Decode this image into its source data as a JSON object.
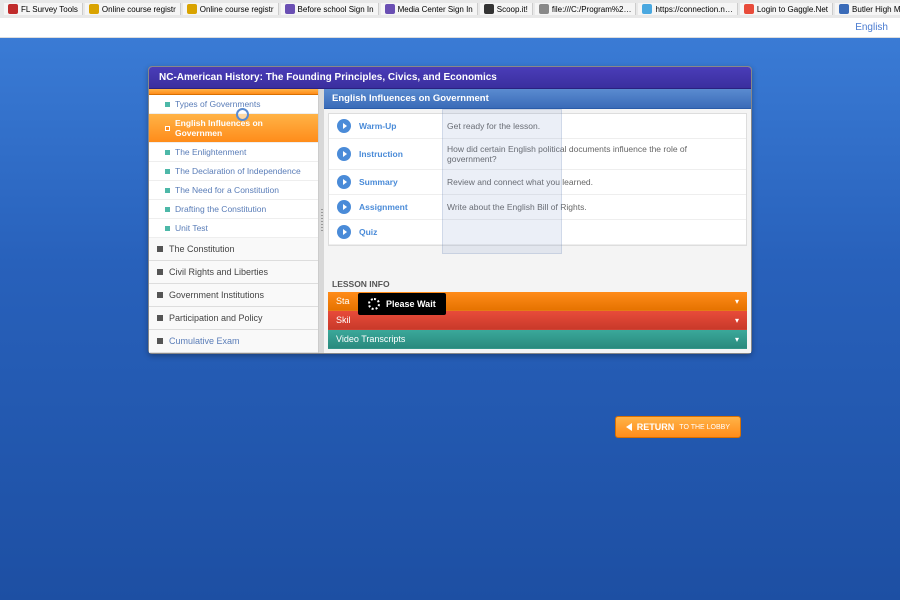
{
  "browserTabs": [
    {
      "label": "FL Survey Tools",
      "favColor": "#c02b2b"
    },
    {
      "label": "Online course registr",
      "favColor": "#d9a300"
    },
    {
      "label": "Online course registr",
      "favColor": "#d9a300"
    },
    {
      "label": "Before school Sign In",
      "favColor": "#6a4fb3"
    },
    {
      "label": "Media Center Sign In",
      "favColor": "#6a4fb3"
    },
    {
      "label": "Scoop.it!",
      "favColor": "#333"
    },
    {
      "label": "file:///C:/Program%2…",
      "favColor": "#888"
    },
    {
      "label": "https://connection.n…",
      "favColor": "#4aa8e0"
    },
    {
      "label": "Login to Gaggle.Net",
      "favColor": "#e84b3a"
    },
    {
      "label": "Butler High Media Ce",
      "favColor": "#3a6bb8"
    }
  ],
  "languageLink": "English",
  "courseTitle": "NC-American History: The Founding Principles, Civics, and Economics",
  "subItems": [
    {
      "label": "Types of Governments",
      "active": false
    },
    {
      "label": "English Influences on Governmen",
      "active": true
    },
    {
      "label": "The Enlightenment",
      "active": false
    },
    {
      "label": "The Declaration of Independence",
      "active": false
    },
    {
      "label": "The Need for a Constitution",
      "active": false
    },
    {
      "label": "Drafting the Constitution",
      "active": false
    },
    {
      "label": "Unit Test",
      "active": false
    }
  ],
  "units": [
    "The Constitution",
    "Civil Rights and Liberties",
    "Government Institutions",
    "Participation and Policy",
    "Cumulative Exam"
  ],
  "lessonTitle": "English Influences on Government",
  "activities": [
    {
      "name": "Warm-Up",
      "desc": "Get ready for the lesson."
    },
    {
      "name": "Instruction",
      "desc": "How did certain English political documents influence the role of government?"
    },
    {
      "name": "Summary",
      "desc": "Review and connect what you learned."
    },
    {
      "name": "Assignment",
      "desc": "Write about the English Bill of Rights."
    },
    {
      "name": "Quiz",
      "desc": ""
    }
  ],
  "lessonInfoLabel": "LESSON INFO",
  "infoBars": [
    {
      "label": "Sta",
      "cls": "orange"
    },
    {
      "label": "Skil",
      "cls": "red"
    },
    {
      "label": "Video Transcripts",
      "cls": "teal"
    }
  ],
  "loadingText": "Please Wait",
  "returnLabel": "RETURN",
  "toLobby": "TO THE LOBBY"
}
